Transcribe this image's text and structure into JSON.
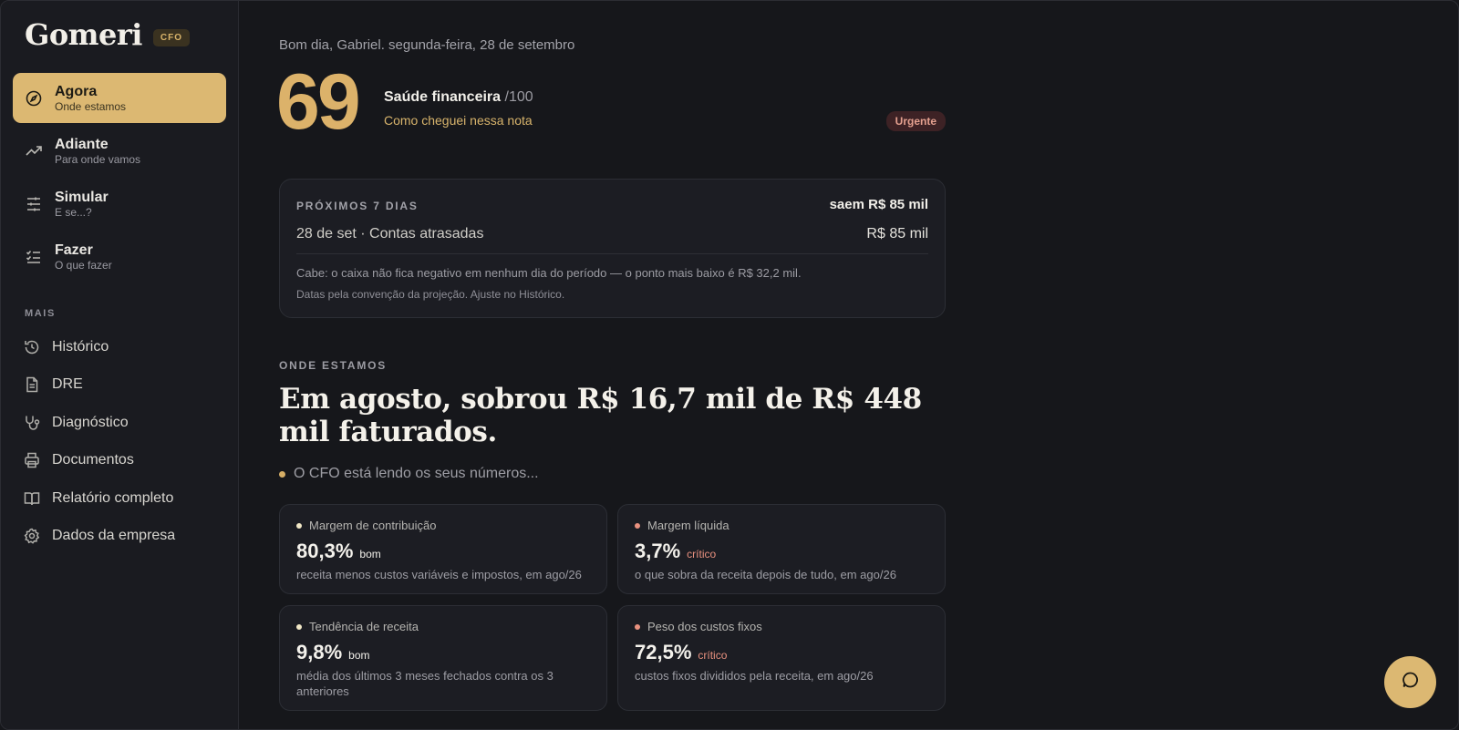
{
  "brand": {
    "name": "Gomeri",
    "badge": "CFO"
  },
  "nav": {
    "main": [
      {
        "title": "Agora",
        "subtitle": "Onde estamos",
        "icon": "compass-icon",
        "active": true
      },
      {
        "title": "Adiante",
        "subtitle": "Para onde vamos",
        "icon": "trending-up-icon",
        "active": false
      },
      {
        "title": "Simular",
        "subtitle": "E se...?",
        "icon": "sliders-icon",
        "active": false
      },
      {
        "title": "Fazer",
        "subtitle": "O que fazer",
        "icon": "checklist-icon",
        "active": false
      }
    ],
    "more_label": "MAIS",
    "more": [
      {
        "label": "Histórico",
        "icon": "history-icon"
      },
      {
        "label": "DRE",
        "icon": "document-icon"
      },
      {
        "label": "Diagnóstico",
        "icon": "stethoscope-icon"
      },
      {
        "label": "Documentos",
        "icon": "printer-icon"
      },
      {
        "label": "Relatório completo",
        "icon": "book-icon"
      },
      {
        "label": "Dados da empresa",
        "icon": "gear-icon"
      }
    ]
  },
  "header": {
    "greeting": "Bom dia, Gabriel. segunda-feira, 28 de setembro",
    "score": "69",
    "health_title": "Saúde financeira",
    "health_of": "/100",
    "health_link": "Como cheguei nessa nota",
    "urgent_badge": "Urgente"
  },
  "next7": {
    "label": "PRÓXIMOS 7 DIAS",
    "summary": "saem R$ 85 mil",
    "row_label": "28 de set · Contas atrasadas",
    "row_value": "R$ 85 mil",
    "note1": "Cabe: o caixa não fica negativo em nenhum dia do período — o ponto mais baixo é R$ 32,2 mil.",
    "note2": "Datas pela convenção da projeção. Ajuste no Histórico."
  },
  "where": {
    "label": "ONDE ESTAMOS",
    "headline": "Em agosto, sobrou R$ 16,7 mil de R$ 448 mil faturados.",
    "reading": "O CFO está lendo os seus números..."
  },
  "metrics": [
    {
      "title": "Margem de contribuição",
      "value": "80,3%",
      "status": "bom",
      "status_color": "#f2f0ea",
      "dot_color": "#f1e7c6",
      "desc": "receita menos custos variáveis e impostos, em ago/26"
    },
    {
      "title": "Margem líquida",
      "value": "3,7%",
      "status": "crítico",
      "status_color": "#e9917f",
      "dot_color": "#e9917f",
      "desc": "o que sobra da receita depois de tudo, em ago/26"
    },
    {
      "title": "Tendência de receita",
      "value": "9,8%",
      "status": "bom",
      "status_color": "#f2f0ea",
      "dot_color": "#f1e7c6",
      "desc": "média dos últimos 3 meses fechados contra os 3 anteriores"
    },
    {
      "title": "Peso dos custos fixos",
      "value": "72,5%",
      "status": "crítico",
      "status_color": "#e9917f",
      "dot_color": "#e9917f",
      "desc": "custos fixos divididos pela receita, em ago/26"
    }
  ],
  "colors": {
    "accent": "#dcb872",
    "background": "#16171b",
    "critical": "#e9917f"
  },
  "chat_icon": "chat-bubble-icon"
}
